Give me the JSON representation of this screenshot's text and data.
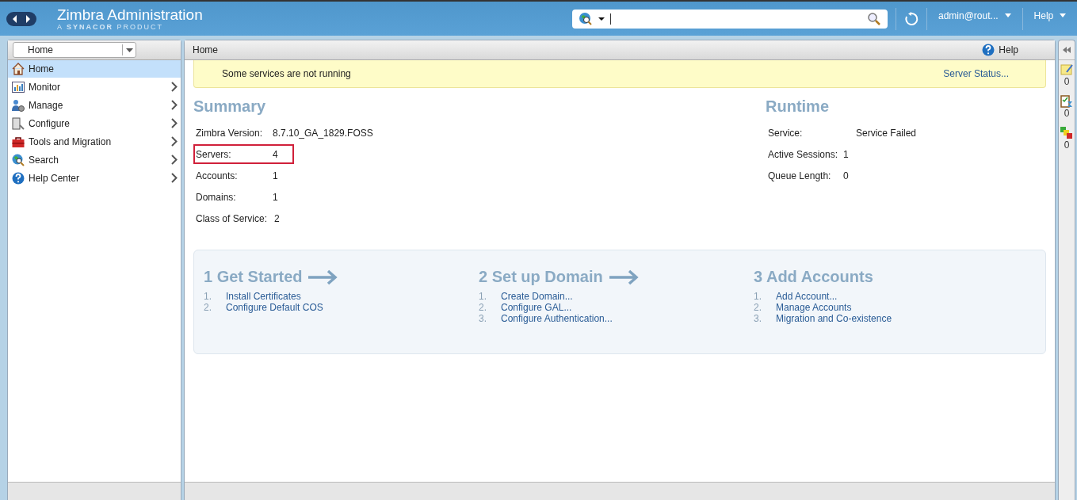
{
  "header": {
    "title": "Zimbra Administration",
    "subtitle_prefix": "A ",
    "subtitle_brand": "SYNACOR",
    "subtitle_suffix": " PRODUCT",
    "user": "admin@rout...",
    "help": "Help"
  },
  "nav": {
    "breadcrumb": "Home"
  },
  "sidebar": {
    "items": [
      {
        "label": "Home",
        "selected": true,
        "has_submenu": false
      },
      {
        "label": "Monitor",
        "selected": false,
        "has_submenu": true
      },
      {
        "label": "Manage",
        "selected": false,
        "has_submenu": true
      },
      {
        "label": "Configure",
        "selected": false,
        "has_submenu": true
      },
      {
        "label": "Tools and Migration",
        "selected": false,
        "has_submenu": true
      },
      {
        "label": "Search",
        "selected": false,
        "has_submenu": true
      },
      {
        "label": "Help Center",
        "selected": false,
        "has_submenu": true
      }
    ]
  },
  "main": {
    "title": "Home",
    "help": "Help",
    "alert": {
      "message": "Some services are not running",
      "link": "Server Status..."
    },
    "summary": {
      "title": "Summary",
      "rows": [
        {
          "label": "Zimbra Version:",
          "value": "8.7.10_GA_1829.FOSS",
          "highlighted": false
        },
        {
          "label": "Servers:",
          "value": "4",
          "highlighted": true
        },
        {
          "label": "Accounts:",
          "value": "1",
          "highlighted": false
        },
        {
          "label": "Domains:",
          "value": "1",
          "highlighted": false
        },
        {
          "label": "Class of Service:",
          "value": "2",
          "highlighted": false
        }
      ]
    },
    "runtime": {
      "title": "Runtime",
      "rows": [
        {
          "label": "Service:",
          "value": "Service Failed"
        },
        {
          "label": "Active Sessions:",
          "value": "1"
        },
        {
          "label": "Queue Length:",
          "value": "0"
        }
      ]
    },
    "steps": [
      {
        "title": "1 Get Started",
        "links": [
          {
            "num": "1.",
            "label": "Install Certificates"
          },
          {
            "num": "2.",
            "label": "Configure Default COS"
          }
        ]
      },
      {
        "title": "2 Set up Domain",
        "links": [
          {
            "num": "1.",
            "label": "Create Domain..."
          },
          {
            "num": "2.",
            "label": "Configure GAL..."
          },
          {
            "num": "3.",
            "label": "Configure Authentication..."
          }
        ]
      },
      {
        "title": "3 Add Accounts",
        "links": [
          {
            "num": "1.",
            "label": "Add Account..."
          },
          {
            "num": "2.",
            "label": "Manage Accounts"
          },
          {
            "num": "3.",
            "label": "Migration and Co-existence"
          }
        ]
      }
    ]
  },
  "right_panel": {
    "items": [
      {
        "count": "0"
      },
      {
        "count": "0"
      },
      {
        "count": "0"
      }
    ]
  }
}
